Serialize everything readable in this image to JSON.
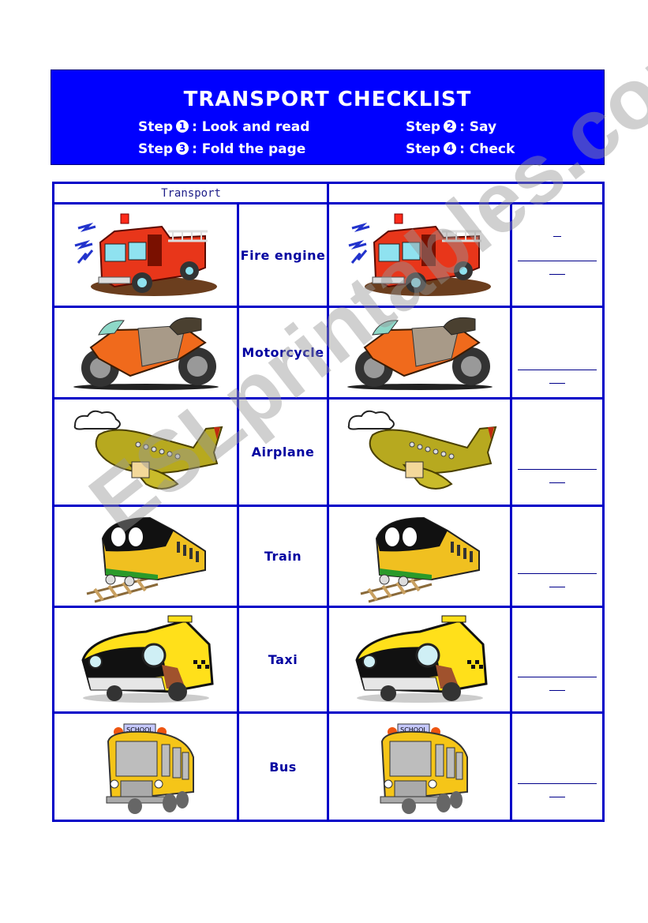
{
  "banner": {
    "title": "TRANSPORT CHECKLIST",
    "steps": [
      {
        "label": "Step",
        "num": "1",
        "text": ": Look and read"
      },
      {
        "label": "Step",
        "num": "2",
        "text": ": Say"
      },
      {
        "label": "Step",
        "num": "3",
        "text": ": Fold the page"
      },
      {
        "label": "Step",
        "num": "4",
        "text": ": Check"
      }
    ],
    "color": "#0000ff"
  },
  "table": {
    "header_left": "Transport",
    "header_right": "________________",
    "rows": [
      {
        "icon": "fire-engine-icon",
        "word": "Fire engine"
      },
      {
        "icon": "motorcycle-icon",
        "word": "Motorcycle"
      },
      {
        "icon": "airplane-icon",
        "word": "Airplane"
      },
      {
        "icon": "train-icon",
        "word": "Train"
      },
      {
        "icon": "taxi-icon",
        "word": "Taxi"
      },
      {
        "icon": "bus-icon",
        "word": "Bus"
      }
    ],
    "border_color": "#0000c8",
    "text_color": "#0000a0"
  },
  "watermark": "ESLprintables.com"
}
